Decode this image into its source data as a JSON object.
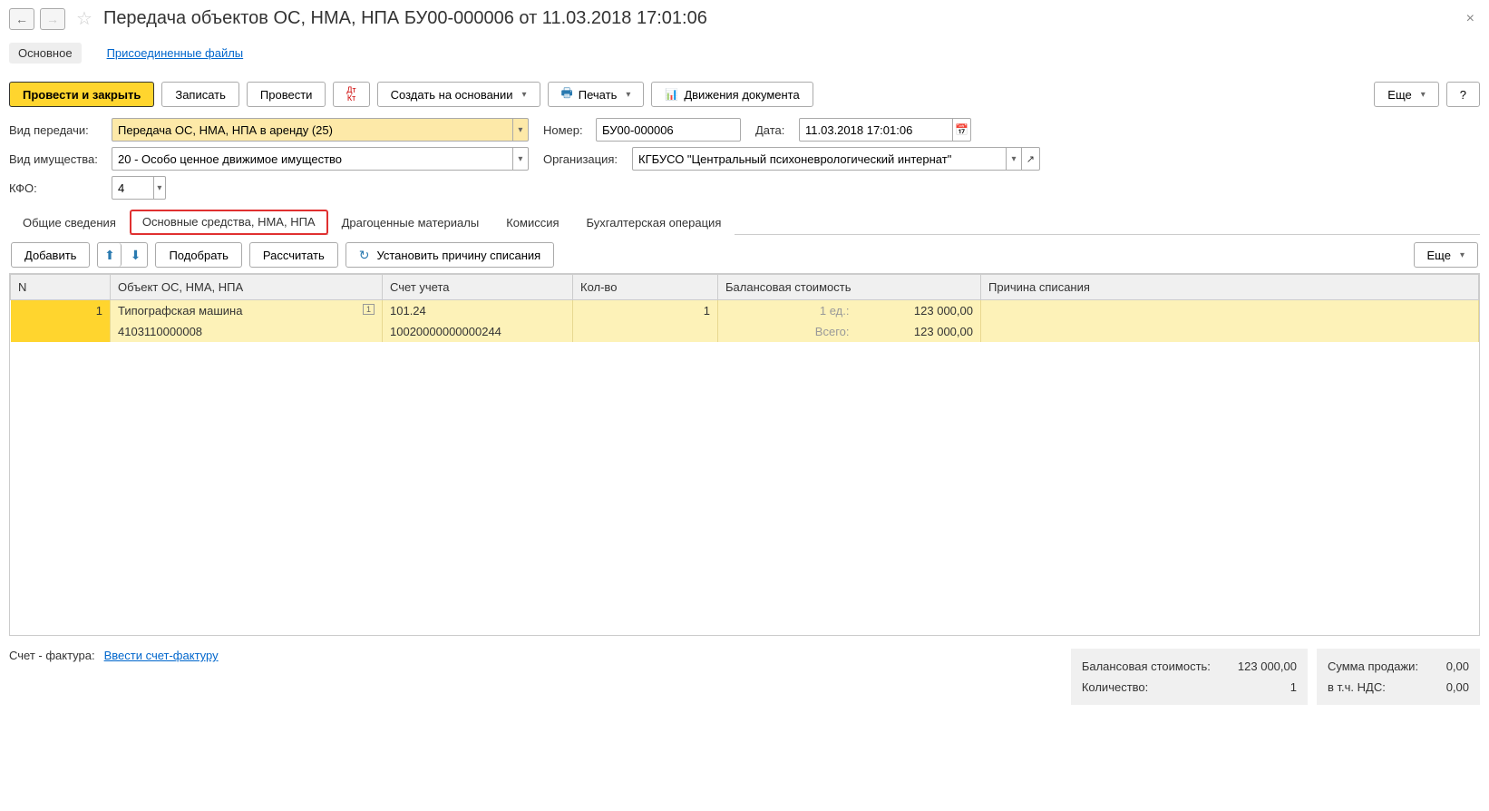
{
  "header": {
    "title": "Передача объектов ОС, НМА, НПА БУ00-000006 от 11.03.2018 17:01:06"
  },
  "nav": {
    "main": "Основное",
    "files": "Присоединенные файлы"
  },
  "toolbar": {
    "post_close": "Провести и закрыть",
    "save": "Записать",
    "post": "Провести",
    "create_based": "Создать на основании",
    "print": "Печать",
    "movements": "Движения документа",
    "more": "Еще",
    "help": "?"
  },
  "form": {
    "transfer_type_label": "Вид передачи:",
    "transfer_type_value": "Передача ОС, НМА, НПА в аренду (25)",
    "number_label": "Номер:",
    "number_value": "БУ00-000006",
    "date_label": "Дата:",
    "date_value": "11.03.2018 17:01:06",
    "property_type_label": "Вид имущества:",
    "property_type_value": "20 - Особо ценное движимое имущество",
    "org_label": "Организация:",
    "org_value": "КГБУСО \"Центральный психоневрологический интернат\"",
    "kfo_label": "КФО:",
    "kfo_value": "4"
  },
  "tabs": {
    "general": "Общие сведения",
    "assets": "Основные средства, НМА, НПА",
    "precious": "Драгоценные материалы",
    "commission": "Комиссия",
    "accounting": "Бухгалтерская операция"
  },
  "tab_toolbar": {
    "add": "Добавить",
    "select": "Подобрать",
    "calculate": "Рассчитать",
    "set_reason": "Установить причину списания",
    "more": "Еще"
  },
  "table": {
    "headers": {
      "n": "N",
      "object": "Объект ОС, НМА, НПА",
      "account": "Счет учета",
      "qty": "Кол-во",
      "balance": "Балансовая стоимость",
      "reason": "Причина списания"
    },
    "rows": [
      {
        "n": "1",
        "object1": "Типографская машина",
        "ind": "1",
        "account1": "101.24",
        "qty": "1",
        "balance_label1": "1 ед.:",
        "balance_val1": "123 000,00",
        "object2": "4103110000008",
        "account2": "10020000000000244",
        "balance_label2": "Всего:",
        "balance_val2": "123 000,00"
      }
    ]
  },
  "footer": {
    "invoice_label": "Счет - фактура:",
    "invoice_link": "Ввести счет-фактуру",
    "balance_label": "Балансовая стоимость:",
    "balance_val": "123 000,00",
    "qty_label": "Количество:",
    "qty_val": "1",
    "sale_label": "Сумма продажи:",
    "sale_val": "0,00",
    "vat_label": "в т.ч. НДС:",
    "vat_val": "0,00"
  }
}
